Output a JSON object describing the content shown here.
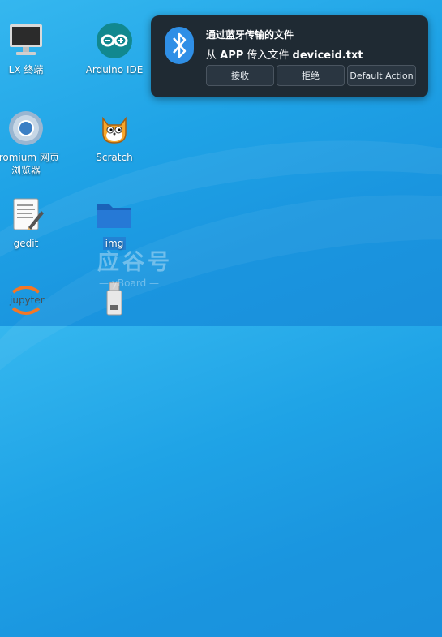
{
  "desktop": {
    "icons": [
      {
        "name": "lx-terminal",
        "label": "LX 终端"
      },
      {
        "name": "arduino-ide",
        "label": "Arduino IDE"
      },
      {
        "name": "chromium",
        "label_line1": "hromium 网页",
        "label_line2": "浏览器"
      },
      {
        "name": "scratch",
        "label": "Scratch"
      },
      {
        "name": "gedit",
        "label": "gedit"
      },
      {
        "name": "img-folder",
        "label": "img"
      },
      {
        "name": "jupyter",
        "label": "jupyter"
      }
    ]
  },
  "notification": {
    "title": "通过蓝牙传输的文件",
    "body_prefix": "从 ",
    "body_app": "APP",
    "body_middle": " 传入文件 ",
    "body_file": "deviceid.txt",
    "buttons": [
      "接收",
      "拒绝",
      "Default Action"
    ],
    "icon": "bluetooth-icon"
  },
  "watermark": {
    "text": "应谷号",
    "sub": "— yBoard —"
  },
  "colors": {
    "accent": "#2f8fe6",
    "notification_bg": "#1f2a33"
  }
}
